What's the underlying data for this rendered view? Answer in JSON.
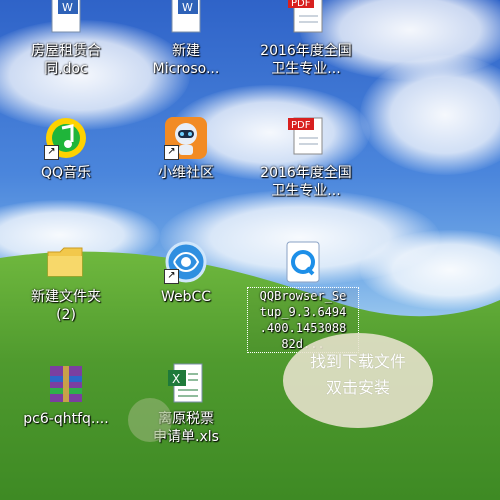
{
  "desktop": {
    "icons": [
      {
        "name": "doc-house-rent",
        "label": "房屋租赁合\n同.doc",
        "icon": "word-doc-icon"
      },
      {
        "name": "doc-new-microsoft",
        "label": "新建\nMicroso...",
        "icon": "word-doc-icon"
      },
      {
        "name": "pdf-2016-health-1",
        "label": "2016年度全国\n卫生专业...",
        "icon": "pdf-file-icon"
      },
      {
        "name": "qq-music",
        "label": "QQ音乐",
        "icon": "qq-music-icon"
      },
      {
        "name": "xiaowei-community",
        "label": "小维社区",
        "icon": "robot-app-icon"
      },
      {
        "name": "pdf-2016-health-2",
        "label": "2016年度全国\n卫生专业...",
        "icon": "pdf-file-icon"
      },
      {
        "name": "new-folder-2",
        "label": "新建文件夹\n(2)",
        "icon": "folder-icon"
      },
      {
        "name": "webcc",
        "label": "WebCC",
        "icon": "webcc-globe-icon"
      },
      {
        "name": "qqbrowser-setup",
        "label": "QQBrowser_Se\ntup_9.3.6494\n.400.1453088\n82d...",
        "icon": "qqbrowser-setup-icon"
      },
      {
        "name": "pc6-archive",
        "label": "pc6-qhtfq....",
        "icon": "winrar-archive-icon"
      },
      {
        "name": "tax-form-xls",
        "label": "离原税票\n申请单.xls",
        "icon": "excel-file-icon"
      }
    ],
    "bubble": {
      "line1": "找到下载文件",
      "line2": "双击安装"
    },
    "colors": {
      "sky": "#4b86dc",
      "grass": "#4f9a2e",
      "pdf_red": "#d8201f",
      "excel_green": "#1f7a3a"
    }
  }
}
